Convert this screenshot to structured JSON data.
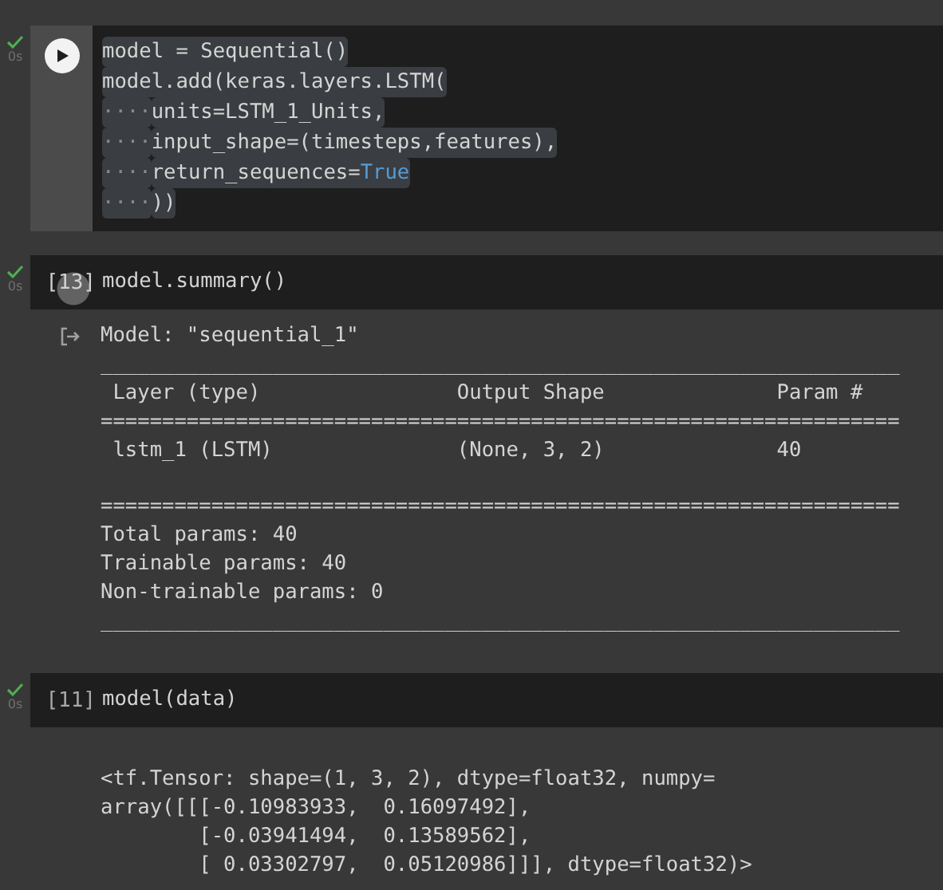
{
  "cells": [
    {
      "done": true,
      "time": "0s",
      "focused": true,
      "gutter": {
        "kind": "run_button"
      },
      "code": [
        {
          "selected": true,
          "tokens": [
            {
              "kind": "plain",
              "text": "model = Sequential()"
            }
          ]
        },
        {
          "selected": true,
          "tokens": [
            {
              "kind": "plain",
              "text": "model.add(keras.layers.LSTM("
            }
          ]
        },
        {
          "selected": true,
          "indent": "····",
          "tokens": [
            {
              "kind": "plain",
              "text": "units=LSTM_1_Units,"
            }
          ]
        },
        {
          "selected": true,
          "indent": "····",
          "tokens": [
            {
              "kind": "plain",
              "text": "input_shape=(timesteps,features),"
            }
          ]
        },
        {
          "selected": true,
          "indent": "····",
          "tokens": [
            {
              "kind": "plain",
              "text": "return_sequences="
            },
            {
              "kind": "keyword",
              "text": "True"
            }
          ]
        },
        {
          "selected": true,
          "indent": "····",
          "tokens": [
            {
              "kind": "plain",
              "text": "))"
            }
          ]
        }
      ]
    },
    {
      "done": true,
      "time": "0s",
      "focused": false,
      "gutter": {
        "kind": "count_hover",
        "text": "[13]"
      },
      "code": [
        {
          "selected": false,
          "tokens": [
            {
              "kind": "plain",
              "text": "model.summary()"
            }
          ]
        }
      ],
      "output": {
        "icon": true,
        "lines": [
          {
            "text": "Model: \"sequential_1\""
          },
          {
            "text": "_________________________________________________________________"
          },
          {
            "text": " Layer (type)                Output Shape              Param #   "
          },
          {
            "text": "================================================================="
          },
          {
            "text": " lstm_1 (LSTM)               (None, 3, 2)              40        "
          },
          {
            "text": "=================================================================",
            "space_before": true
          },
          {
            "text": "Total params: 40"
          },
          {
            "text": "Trainable params: 40"
          },
          {
            "text": "Non-trainable params: 0"
          },
          {
            "text": "_________________________________________________________________"
          }
        ]
      }
    },
    {
      "done": true,
      "time": "0s",
      "focused": false,
      "gutter": {
        "kind": "count",
        "text": "[11]"
      },
      "code": [
        {
          "selected": false,
          "tokens": [
            {
              "kind": "plain",
              "text": "model(data)"
            }
          ]
        }
      ],
      "output": {
        "icon": false,
        "lines": [
          {
            "text": "<tf.Tensor: shape=(1, 3, 2), dtype=float32, numpy="
          },
          {
            "text": "array([[[-0.10983933,  0.16097492],"
          },
          {
            "text": "        [-0.03941494,  0.13589562],"
          },
          {
            "text": "        [ 0.03302797,  0.05120986]]], dtype=float32)>"
          }
        ]
      }
    }
  ]
}
